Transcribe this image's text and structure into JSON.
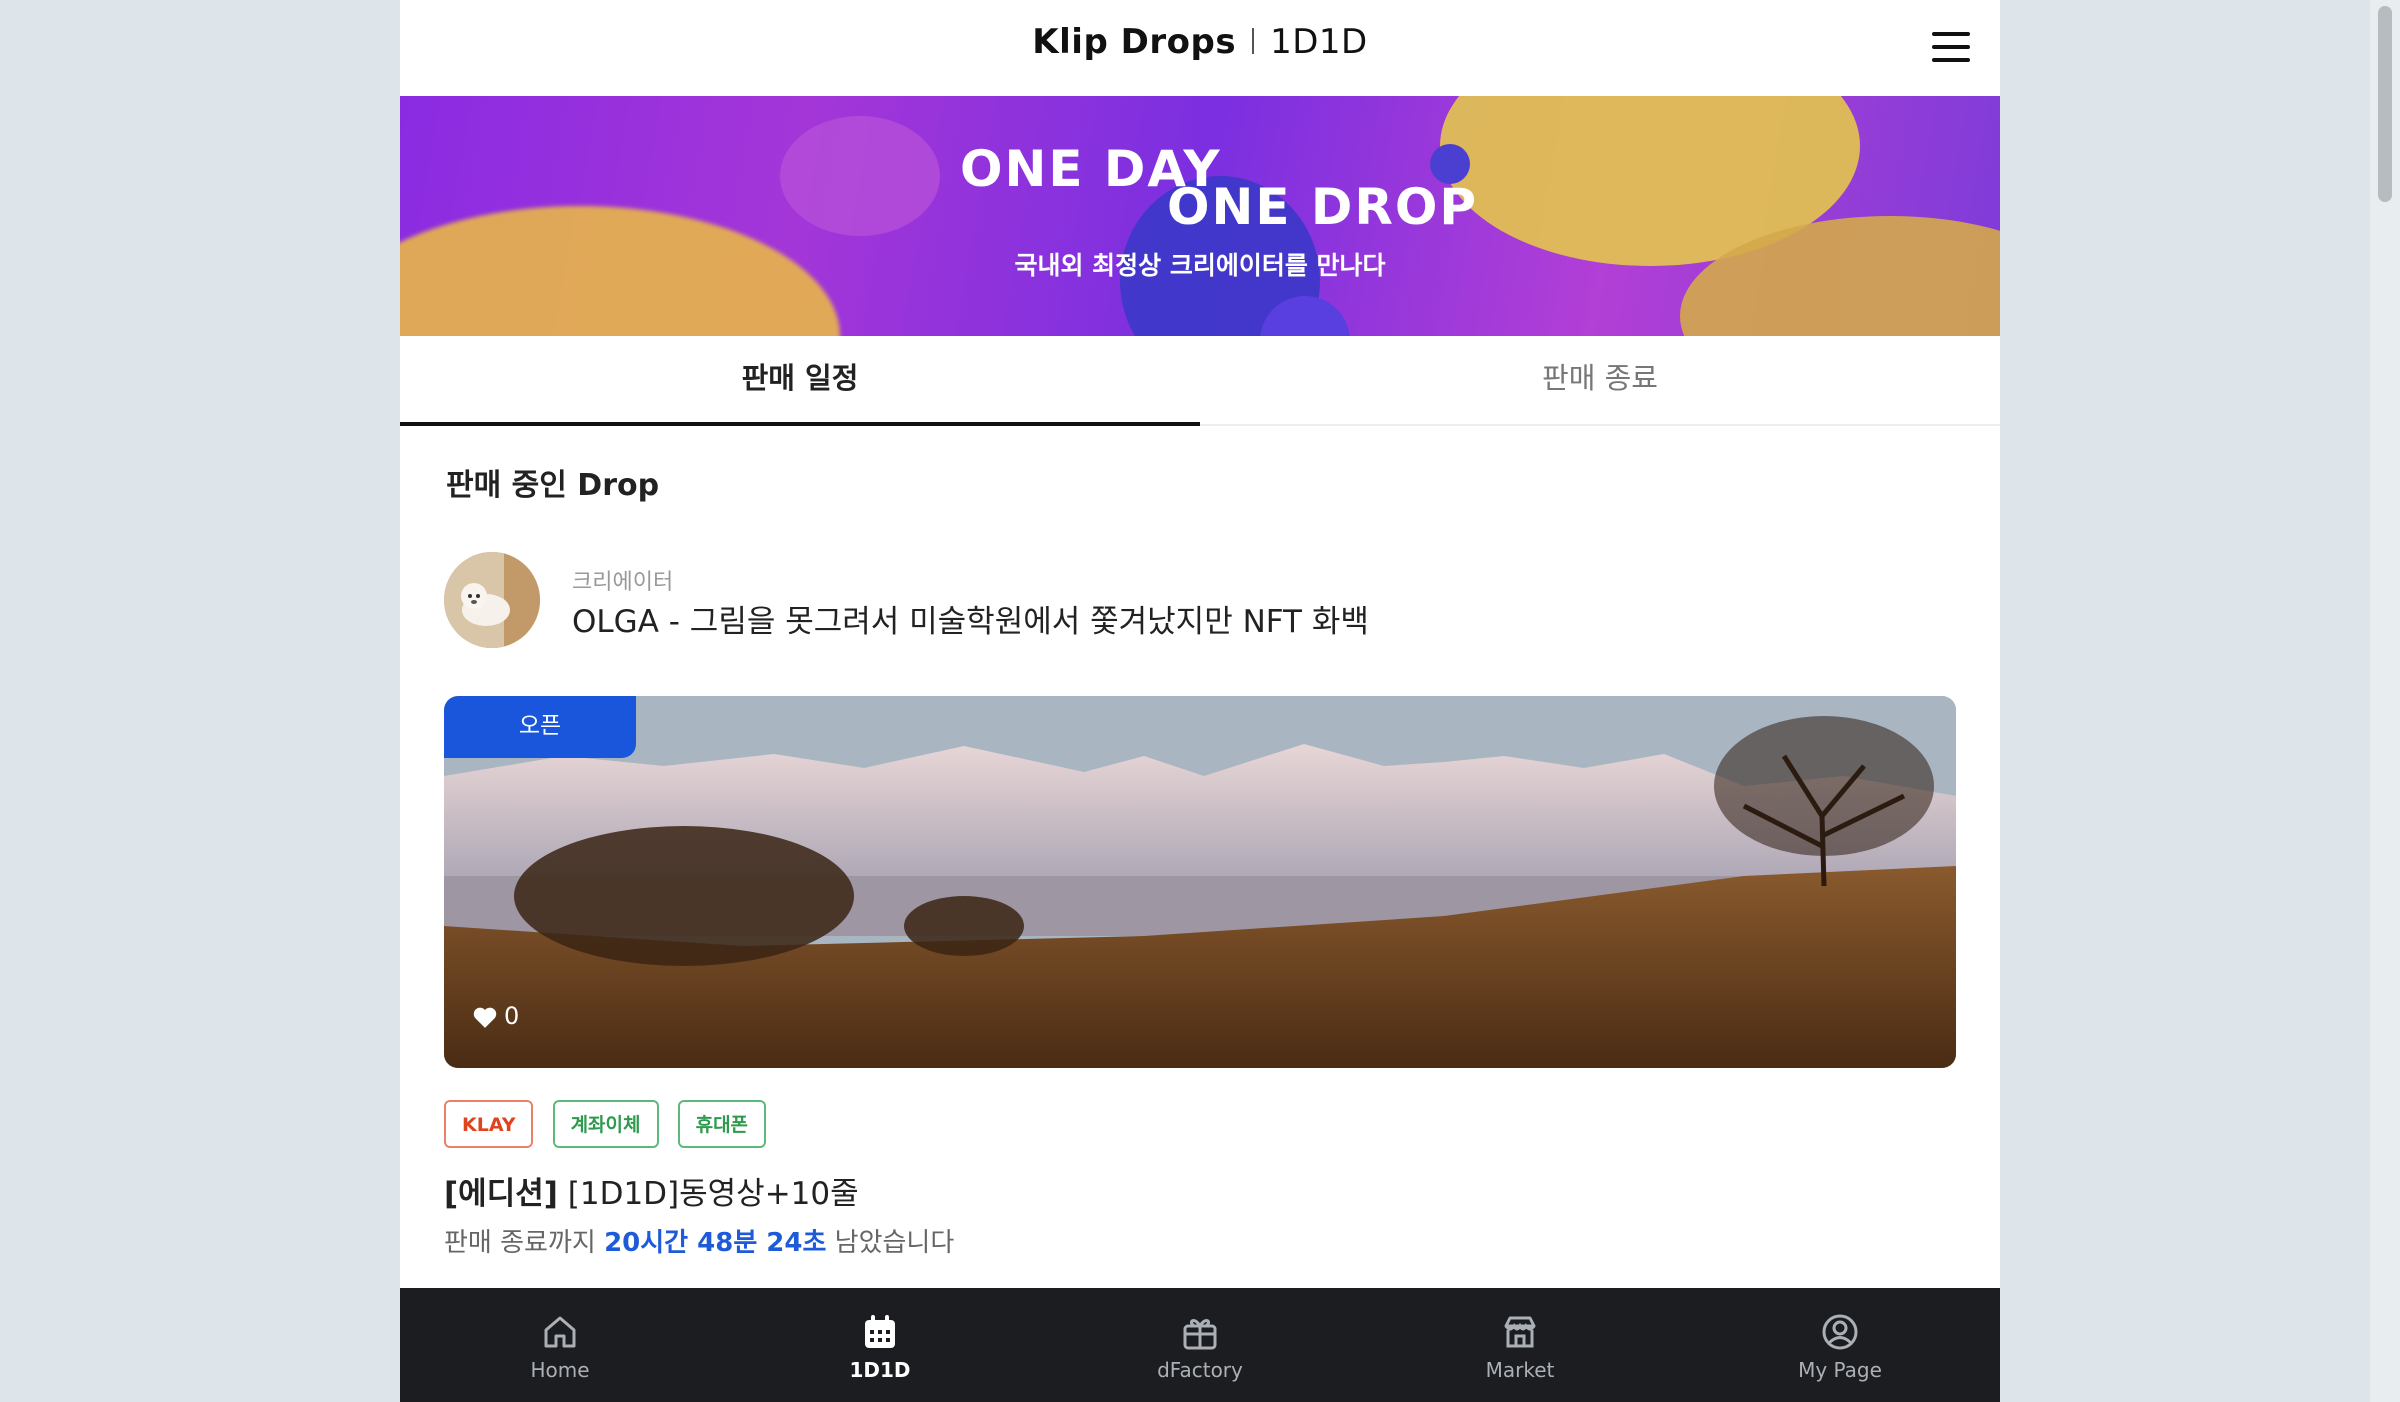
{
  "header": {
    "brand": "Klip Drops",
    "section": "1D1D"
  },
  "banner": {
    "line1": "ONE DAY",
    "line2": "ONE DROP",
    "subtitle": "국내외 최정상 크리에이터를 만나다"
  },
  "tabs": [
    {
      "label": "판매 일정",
      "active": true
    },
    {
      "label": "판매 종료",
      "active": false
    }
  ],
  "section_title": "판매 중인 Drop",
  "creator": {
    "label": "크리에이터",
    "name": "OLGA - 그림을 못그려서 미술학원에서 쫓겨났지만 NFT 화백"
  },
  "card": {
    "status_badge": "오픈",
    "likes": "0",
    "tags": [
      "KLAY",
      "계좌이체",
      "휴대폰"
    ],
    "title_prefix": "[에디션]",
    "title": " [1D1D]동영상+10줄",
    "remain_prefix": "판매 종료까지 ",
    "remain_time": "20시간 48분 24초",
    "remain_suffix": " 남았습니다"
  },
  "bottom_nav": [
    {
      "label": "Home",
      "icon": "home-icon",
      "active": false
    },
    {
      "label": "1D1D",
      "icon": "calendar-icon",
      "active": true
    },
    {
      "label": "dFactory",
      "icon": "gift-icon",
      "active": false
    },
    {
      "label": "Market",
      "icon": "store-icon",
      "active": false
    },
    {
      "label": "My Page",
      "icon": "user-circle-icon",
      "active": false
    }
  ],
  "colors": {
    "accent_blue": "#1a56db",
    "time_blue": "#1e5bd8",
    "klay_tag": "#e0441f",
    "green_tag": "#2e9a4d",
    "nav_bg": "#1b1d20"
  }
}
